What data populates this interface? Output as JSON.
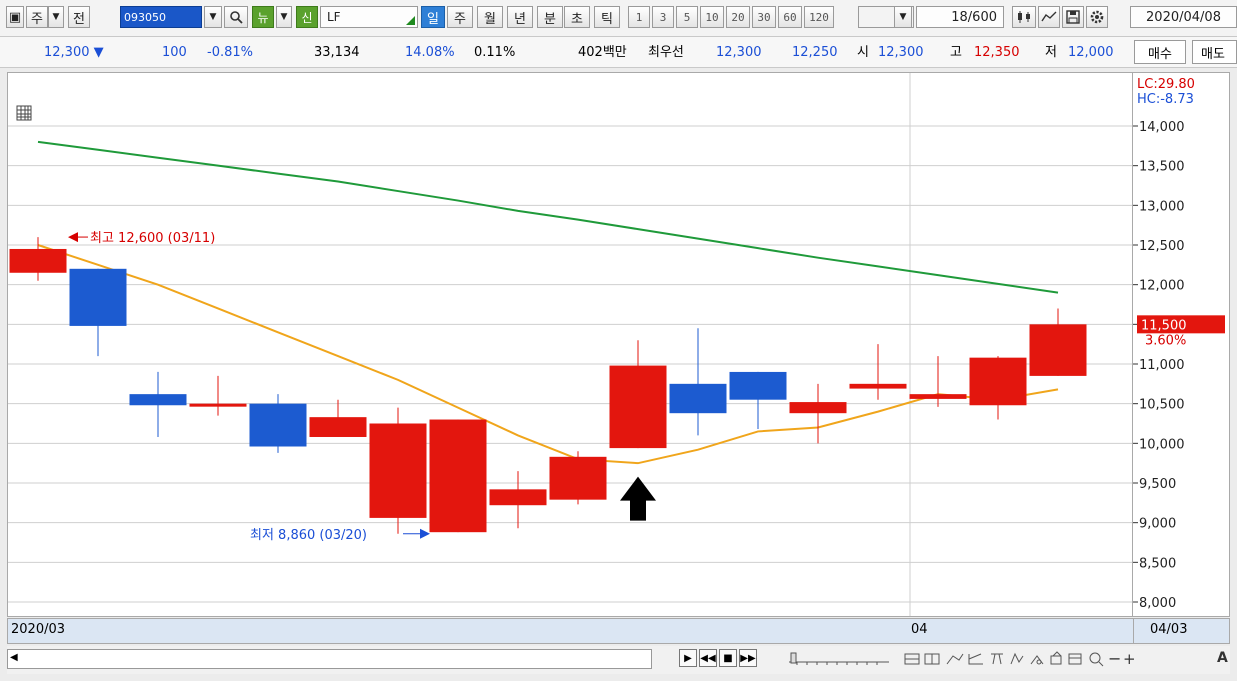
{
  "toolbar": {
    "tab_ju": "주",
    "tab_jeon": "전",
    "stock_code": "093050",
    "tab_new": "뉴",
    "tab_sin": "신",
    "stock_name": "LF",
    "periods": [
      "일",
      "주",
      "월",
      "년",
      "분",
      "초",
      "틱"
    ],
    "active_period": "일",
    "intervals": [
      "1",
      "3",
      "5",
      "10",
      "20",
      "30",
      "60",
      "120"
    ],
    "count": "18",
    "count_max": "/600",
    "date": "2020/04/08"
  },
  "quote": {
    "price": "12,300",
    "change": "100",
    "change_pct": "-0.81%",
    "volume": "33,134",
    "ratio1": "14.08%",
    "ratio2": "0.11%",
    "amount": "402백만",
    "best_label": "최우선",
    "best_ask": "12,300",
    "best_bid": "12,250",
    "open_label": "시",
    "open": "12,300",
    "high_label": "고",
    "high": "12,350",
    "low_label": "저",
    "low": "12,000",
    "buy_label": "매수",
    "sell_label": "매도"
  },
  "chart_data": {
    "type": "candlestick",
    "candles": [
      {
        "o": 12150,
        "h": 12600,
        "l": 12050,
        "c": 12450
      },
      {
        "o": 12200,
        "h": 12200,
        "l": 11100,
        "c": 11480
      },
      {
        "o": 10620,
        "h": 10900,
        "l": 10080,
        "c": 10480
      },
      {
        "o": 10500,
        "h": 10850,
        "l": 10350,
        "c": 10500
      },
      {
        "o": 10500,
        "h": 10620,
        "l": 9880,
        "c": 9960
      },
      {
        "o": 10080,
        "h": 10550,
        "l": 10080,
        "c": 10330
      },
      {
        "o": 9060,
        "h": 10450,
        "l": 8860,
        "c": 10250
      },
      {
        "o": 8880,
        "h": 10300,
        "l": 8880,
        "c": 10300
      },
      {
        "o": 9220,
        "h": 9650,
        "l": 8930,
        "c": 9420
      },
      {
        "o": 9290,
        "h": 9900,
        "l": 9230,
        "c": 9830
      },
      {
        "o": 9940,
        "h": 11300,
        "l": 9940,
        "c": 10980
      },
      {
        "o": 10750,
        "h": 11450,
        "l": 10100,
        "c": 10380
      },
      {
        "o": 10900,
        "h": 10900,
        "l": 10180,
        "c": 10550
      },
      {
        "o": 10380,
        "h": 10750,
        "l": 10000,
        "c": 10520
      },
      {
        "o": 10690,
        "h": 11250,
        "l": 10550,
        "c": 10750
      },
      {
        "o": 10560,
        "h": 11100,
        "l": 10460,
        "c": 10620
      },
      {
        "o": 10480,
        "h": 11100,
        "l": 10300,
        "c": 11080
      },
      {
        "o": 10850,
        "h": 11700,
        "l": 10850,
        "c": 11500
      }
    ],
    "ma_short": [
      12500,
      12250,
      12000,
      11700,
      11400,
      11100,
      10800,
      10450,
      10100,
      9800,
      9750,
      9920,
      10150,
      10200,
      10400,
      10620,
      10550,
      10680
    ],
    "ma_long": [
      13800,
      13700,
      13600,
      13500,
      13400,
      13300,
      13180,
      13060,
      12930,
      12820,
      12700,
      12580,
      12460,
      12340,
      12230,
      12120,
      12010,
      11900
    ],
    "yticks": [
      "14,000",
      "13,500",
      "13,000",
      "12,500",
      "12,000",
      "11,500",
      "11,000",
      "10,500",
      "10,000",
      "9,500",
      "9,000",
      "8,500",
      "8,000"
    ],
    "ylim": [
      7800,
      14200
    ],
    "high_label": "최고 12,600 (03/11)",
    "low_label": "최저 8,860 (03/20)",
    "lc_label": "LC:29.80",
    "hc_label": "HC:-8.73",
    "last_price": "11,500",
    "last_pct": "3.60%",
    "x_start": "2020/03",
    "x_mid": "04",
    "x_end": "04/03",
    "colors": {
      "up": "#e3160e",
      "down": "#1c5bd0",
      "ma_short": "#f0a51b",
      "ma_long": "#1f9a3a"
    }
  }
}
